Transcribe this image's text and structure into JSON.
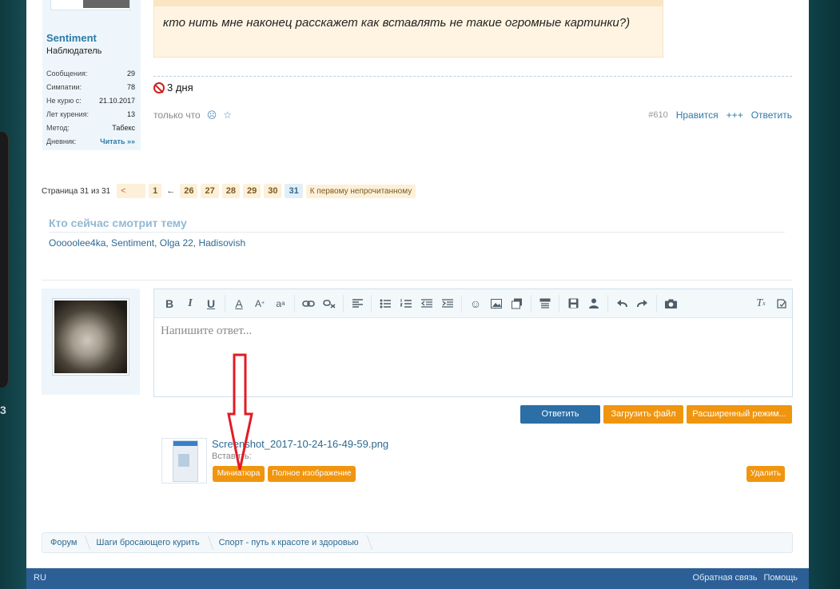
{
  "user": {
    "name": "Sentiment",
    "title": "Наблюдатель",
    "stats": [
      {
        "label": "Сообщения:",
        "value": "29"
      },
      {
        "label": "Симпатии:",
        "value": "78"
      },
      {
        "label": "Не курю с:",
        "value": "21.10.2017"
      },
      {
        "label": "Лет курения:",
        "value": "13"
      },
      {
        "label": "Метод:",
        "value": "Табекс"
      },
      {
        "label": "Дневник:",
        "value": "Читать »»"
      }
    ]
  },
  "post": {
    "quote_text": "кто нить мне наконец расскажет как вставлять не такие огромные картинки?)",
    "signature": "3 дня",
    "time": "только что",
    "number": "#610",
    "like": "Нравится",
    "plus": "+++",
    "reply": "Ответить"
  },
  "pagination": {
    "label": "Страница 31 из 31",
    "prev": "<",
    "pages": [
      "1",
      "26",
      "27",
      "28",
      "29",
      "30",
      "31"
    ],
    "dash": "←",
    "unread": "К первому непрочитанному"
  },
  "viewers": {
    "title": "Кто сейчас смотрит тему",
    "names": "Ooooolеe4ka, Sentiment, Olga 22, Hadisovish"
  },
  "editor": {
    "placeholder": "Напишите ответ...",
    "reply_btn": "Ответить",
    "upload_btn": "Загрузить файл",
    "advanced_btn": "Расширенный режим..."
  },
  "attachment": {
    "filename": "Screenshot_2017-10-24-16-49-59.png",
    "insert_label": "Вставить:",
    "thumb_btn": "Миниатюра",
    "full_btn": "Полное изображение",
    "delete_btn": "Удалить"
  },
  "breadcrumbs": [
    "Форум",
    "Шаги бросающего курить",
    "Спорт - путь к красоте и здоровью"
  ],
  "footer": {
    "lang": "RU",
    "feedback": "Обратная связь",
    "help": "Помощь"
  },
  "background": {
    "digit": "3"
  },
  "colors": {
    "accent": "#2e6a92",
    "button_orange": "#f0950f",
    "button_blue": "#2c6ea6",
    "footer": "#2c5f96",
    "arrow": "#e31b23"
  }
}
